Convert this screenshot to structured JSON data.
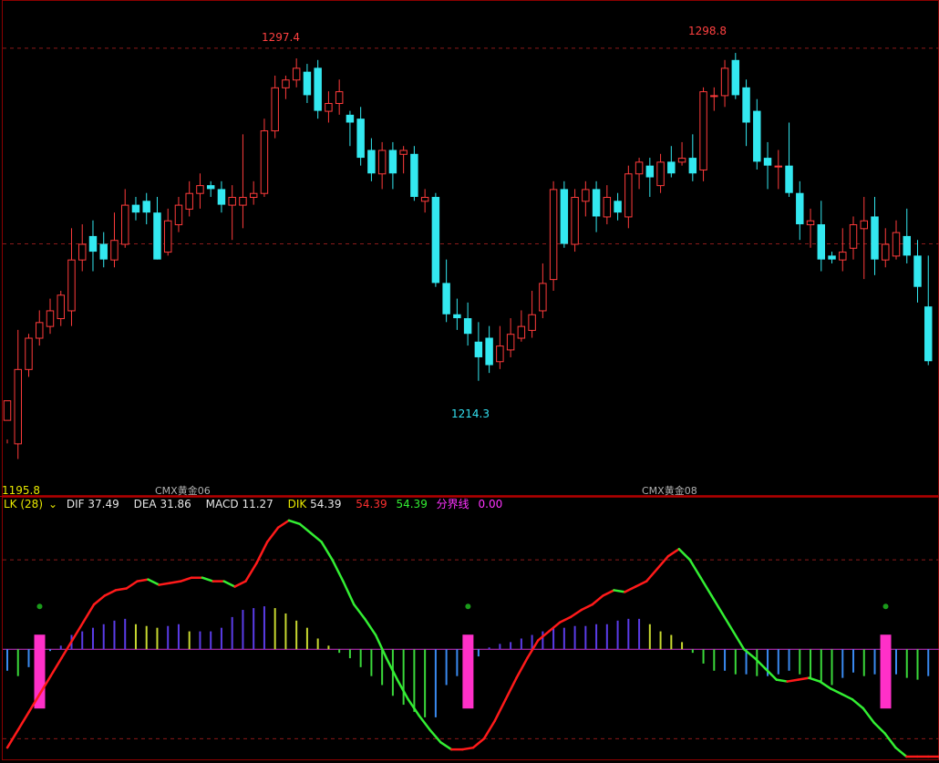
{
  "chart_data": [
    {
      "type": "candlestick",
      "title": "",
      "annotations": {
        "high1": "1297.4",
        "high2": "1298.8",
        "low": "1214.3",
        "bottom_left": "1195.8"
      },
      "x_tick_labels": [
        "CMX黄金06",
        "CMX黄金08"
      ],
      "ylim": [
        1190,
        1310
      ],
      "candles": [
        [
          1205,
          1210,
          1200,
          1199
        ],
        [
          1199,
          1218,
          1228,
          1195
        ],
        [
          1218,
          1226,
          1227,
          1216
        ],
        [
          1226,
          1230,
          1233,
          1224
        ],
        [
          1229,
          1233,
          1236,
          1227
        ],
        [
          1231,
          1237,
          1238,
          1229
        ],
        [
          1233,
          1246,
          1254,
          1229
        ],
        [
          1246,
          1250,
          1255,
          1243
        ],
        [
          1252,
          1248,
          1256,
          1243
        ],
        [
          1250,
          1246,
          1253,
          1244
        ],
        [
          1246,
          1251,
          1258,
          1244
        ],
        [
          1250,
          1260,
          1264,
          1249
        ],
        [
          1260,
          1258,
          1262,
          1256
        ],
        [
          1261,
          1258,
          1263,
          1255
        ],
        [
          1258,
          1246,
          1262,
          1246
        ],
        [
          1248,
          1256,
          1259,
          1247
        ],
        [
          1255,
          1260,
          1262,
          1253
        ],
        [
          1259,
          1263,
          1266,
          1257
        ],
        [
          1263,
          1265,
          1268,
          1259
        ],
        [
          1265,
          1264,
          1266,
          1262
        ],
        [
          1264,
          1260,
          1266,
          1258
        ],
        [
          1260,
          1262,
          1265,
          1251
        ],
        [
          1260,
          1262,
          1278,
          1254
        ],
        [
          1262,
          1263,
          1266,
          1260
        ],
        [
          1263,
          1279,
          1282,
          1262
        ],
        [
          1279,
          1290,
          1293,
          1277
        ],
        [
          1290,
          1292,
          1293,
          1287
        ],
        [
          1292,
          1295,
          1297.4,
          1290
        ],
        [
          1294,
          1288,
          1296,
          1286
        ],
        [
          1295,
          1284,
          1297,
          1282
        ],
        [
          1284,
          1286,
          1289,
          1281
        ],
        [
          1286,
          1289,
          1292,
          1283
        ],
        [
          1283,
          1281,
          1284,
          1275
        ],
        [
          1282,
          1272,
          1285,
          1270
        ],
        [
          1274,
          1268,
          1277,
          1266
        ],
        [
          1268,
          1274,
          1276,
          1264
        ],
        [
          1274,
          1268,
          1276,
          1264
        ],
        [
          1273,
          1274,
          1275,
          1268
        ],
        [
          1273,
          1262,
          1275,
          1261
        ],
        [
          1261,
          1262,
          1264,
          1258
        ],
        [
          1262,
          1240,
          1263,
          1239
        ],
        [
          1240,
          1232,
          1246,
          1230
        ],
        [
          1232,
          1231,
          1236,
          1228
        ],
        [
          1231,
          1227,
          1235,
          1224
        ],
        [
          1225,
          1221,
          1230,
          1215
        ],
        [
          1226,
          1219,
          1229,
          1217
        ],
        [
          1220,
          1224,
          1229,
          1218
        ],
        [
          1223,
          1227,
          1231,
          1221
        ],
        [
          1226,
          1229,
          1233,
          1225
        ],
        [
          1228,
          1232,
          1238,
          1226
        ],
        [
          1233,
          1240,
          1245,
          1231
        ],
        [
          1241,
          1264,
          1266,
          1238
        ],
        [
          1264,
          1250,
          1266,
          1249
        ],
        [
          1250,
          1262,
          1264,
          1248
        ],
        [
          1261,
          1264,
          1266,
          1257
        ],
        [
          1264,
          1257,
          1266,
          1253
        ],
        [
          1257,
          1262,
          1265,
          1255
        ],
        [
          1261,
          1258,
          1263,
          1256
        ],
        [
          1257,
          1268,
          1270,
          1254
        ],
        [
          1268,
          1271,
          1272,
          1264
        ],
        [
          1270,
          1267,
          1272,
          1262
        ],
        [
          1265,
          1271,
          1273,
          1263
        ],
        [
          1271,
          1268,
          1275,
          1267
        ],
        [
          1271,
          1272,
          1276,
          1270
        ],
        [
          1272,
          1268,
          1278,
          1266
        ],
        [
          1269,
          1289,
          1290,
          1266
        ],
        [
          1288,
          1288,
          1290,
          1284
        ],
        [
          1288,
          1295,
          1297,
          1285
        ],
        [
          1297,
          1288,
          1298.8,
          1287
        ],
        [
          1290,
          1281,
          1292,
          1275
        ],
        [
          1284,
          1271,
          1287,
          1269
        ],
        [
          1272,
          1270,
          1276,
          1264
        ],
        [
          1270,
          1270,
          1274,
          1264
        ],
        [
          1270,
          1263,
          1281,
          1262
        ],
        [
          1263,
          1255,
          1266,
          1251
        ],
        [
          1255,
          1256,
          1259,
          1249
        ],
        [
          1255,
          1246,
          1261,
          1243
        ],
        [
          1247,
          1246,
          1248,
          1245
        ],
        [
          1246,
          1248,
          1254,
          1243
        ],
        [
          1249,
          1255,
          1257,
          1246
        ],
        [
          1254,
          1256,
          1262,
          1241
        ],
        [
          1257,
          1246,
          1262,
          1242
        ],
        [
          1246,
          1250,
          1254,
          1244
        ],
        [
          1247,
          1253,
          1256,
          1246
        ],
        [
          1252,
          1247,
          1259,
          1245
        ],
        [
          1247,
          1239,
          1251,
          1235
        ],
        [
          1234,
          1220,
          1247,
          1219
        ]
      ]
    },
    {
      "type": "macd",
      "indicator": "LK (28)",
      "DIF": "37.49",
      "DEA": "31.86",
      "MACD": "11.27",
      "DIK": "54.39",
      "red_value": "54.39",
      "green_value": "54.39",
      "zero_line_label": "分界线",
      "zero_line_value": "0.00",
      "ylim": [
        -60,
        75
      ],
      "line_values": [
        -55,
        -45,
        -35,
        -25,
        -15,
        -5,
        5,
        15,
        25,
        30,
        33,
        34,
        38,
        39,
        36,
        37,
        38,
        40,
        40,
        38,
        38,
        35,
        38,
        48,
        60,
        68,
        72,
        70,
        65,
        60,
        50,
        38,
        25,
        17,
        8,
        -5,
        -17,
        -28,
        -37,
        -45,
        -52,
        -56,
        -56,
        -55,
        -50,
        -40,
        -28,
        -16,
        -5,
        5,
        10,
        15,
        18,
        22,
        25,
        30,
        33,
        32,
        35,
        38,
        45,
        52,
        56,
        50,
        40,
        30,
        20,
        10,
        0,
        -5,
        -11,
        -17,
        -18,
        -17,
        -16,
        -18,
        -22,
        -25,
        -28,
        -33,
        -41,
        -47,
        -55,
        -60,
        -60,
        -60,
        -60
      ],
      "bar_values": [
        -12,
        -15,
        -10,
        -4,
        -1,
        2,
        8,
        10,
        12,
        14,
        16,
        17,
        14,
        13,
        12,
        13,
        14,
        10,
        10,
        10,
        12,
        18,
        22,
        23,
        24,
        23,
        20,
        16,
        12,
        6,
        2,
        -2,
        -5,
        -10,
        -15,
        -20,
        -26,
        -31,
        -35,
        -38,
        -38,
        -20,
        -15,
        -8,
        -4,
        1,
        3,
        4,
        6,
        8,
        10,
        12,
        12,
        13,
        13,
        14,
        14,
        16,
        17,
        17,
        14,
        10,
        8,
        4,
        -2,
        -8,
        -12,
        -12,
        -14,
        -14,
        -15,
        -15,
        -14,
        -12,
        -14,
        -16,
        -18,
        -20,
        -16,
        -13,
        -15,
        -14,
        -16,
        -14,
        -16,
        -17,
        -15
      ],
      "pink_bars": [
        2,
        42,
        81
      ]
    }
  ]
}
